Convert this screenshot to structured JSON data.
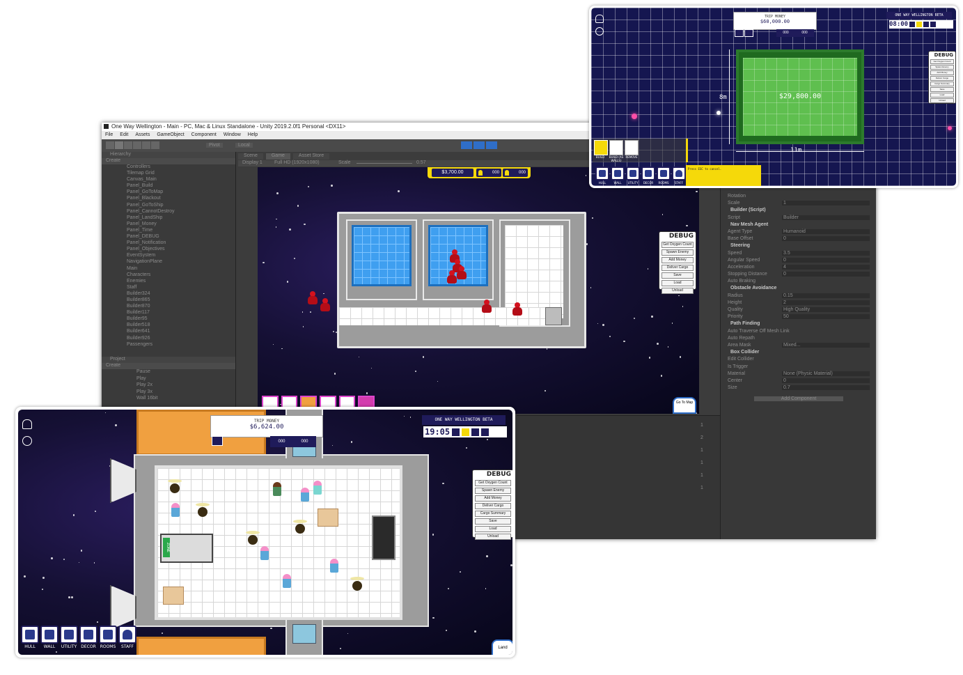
{
  "unity": {
    "title": "One Way Wellington - Main - PC, Mac & Linux Standalone - Unity 2019.2.0f1 Personal <DX11>",
    "menu": [
      "File",
      "Edit",
      "Assets",
      "GameObject",
      "Component",
      "Window",
      "Help"
    ],
    "pivot_label": "Pivot",
    "local_label": "Local",
    "hierarchy_tab": "Hierarchy",
    "scene_tab": "Scene",
    "game_tab": "Game",
    "asset_store_tab": "Asset Store",
    "display_label": "Display 1",
    "resolution_label": "Full HD (1920x1080)",
    "scale_label": "Scale",
    "scale_value": "0.57",
    "create_label": "Create",
    "project_tab": "Project",
    "hierarchy_items": [
      "Controllers",
      "Tilemap Grid",
      "Canvas_Main",
      "Panel_Build",
      "Panel_GoToMap",
      "Panel_Blackout",
      "Panel_GoToShip",
      "Panel_CannotDestroy",
      "Panel_LandShip",
      "Panel_Money",
      "Panel_Time",
      "Panel_DEBUG",
      "Panel_Notification",
      "Panel_Objectives",
      "EventSystem",
      "NavigationPlane",
      "Main",
      "Characters",
      "Enemies",
      "Staff",
      "Builder324",
      "Builder865",
      "Builder870",
      "Builder117",
      "Builder95",
      "Builder518",
      "Builder641",
      "Builder926",
      "Passengers"
    ],
    "project_items": [
      "Pause",
      "Play",
      "Play 2x",
      "Play 3x",
      "Wall 16bit"
    ],
    "inspector": {
      "rotation_label": "Rotation",
      "scale_label": "Scale",
      "builder_script": "Builder (Script)",
      "script_label": "Script",
      "script_value": "Builder",
      "nav_mesh_agent": "Nav Mesh Agent",
      "agent_type_label": "Agent Type",
      "agent_type_value": "Humanoid",
      "base_offset_label": "Base Offset",
      "base_offset_value": "0",
      "steering_header": "Steering",
      "speed_label": "Speed",
      "speed_value": "3.5",
      "angular_speed_label": "Angular Speed",
      "angular_speed_value": "0",
      "acceleration_label": "Acceleration",
      "acceleration_value": "4",
      "stopping_distance_label": "Stopping Distance",
      "stopping_distance_value": "0",
      "auto_braking_label": "Auto Braking",
      "obstacle_header": "Obstacle Avoidance",
      "radius_label": "Radius",
      "radius_value": "0.15",
      "height_label": "Height",
      "height_value": "2",
      "quality_label": "Quality",
      "quality_value": "High Quality",
      "priority_label": "Priority",
      "priority_value": "50",
      "path_header": "Path Finding",
      "auto_traverse_label": "Auto Traverse Off Mesh Link",
      "auto_repath_label": "Auto Repath",
      "area_mask_label": "Area Mask",
      "area_mask_value": "Mixed...",
      "box_collider": "Box Collider",
      "edit_collider_label": "Edit Collider",
      "is_trigger_label": "Is Trigger",
      "material_label": "Material",
      "material_value": "None (Physic Material)",
      "center_label": "Center",
      "size_label": "Size",
      "center_x": "0",
      "center_y": "0",
      "center_z": "0.25",
      "size_x": "0.7",
      "size_y": "1",
      "size_z": "1",
      "scale_x": "1",
      "scale_y": "1",
      "scale_z": "1",
      "add_component": "Add Component"
    },
    "console_numbers": [
      "1",
      "2",
      "1",
      "1",
      "1",
      "1"
    ]
  },
  "game_mid": {
    "money": "$3,700.00",
    "count_a": "000",
    "count_b": "000",
    "go_to_map": "Go To Map"
  },
  "debug": {
    "title": "DEBUG",
    "buttons": [
      "Get Oxygen Count",
      "Spawn Enemy",
      "Add Money",
      "Deliver Cargo",
      "Save",
      "Load",
      "Unload"
    ]
  },
  "debug_bottom": {
    "buttons": [
      "Get Oxygen Count",
      "Spawn Enemy",
      "Add Money",
      "Deliver Cargo",
      "Cargo Summary",
      "Save",
      "Load",
      "Unload"
    ]
  },
  "debug_top": {
    "buttons": [
      "Get Oxygen Count",
      "Spawn Enemy",
      "Add Money",
      "Deliver Cargo",
      "Cargo Summary",
      "Save",
      "Load",
      "Unload"
    ]
  },
  "game_top": {
    "trip_money_label": "TRIP MONEY",
    "trip_money_value": "$60,000.00",
    "beta_label": "ONE WAY WELLINGTON BETA",
    "time": "08:00",
    "count_a": "000",
    "count_b": "000",
    "room_cost": "$29,800.00",
    "dim_height": "8m",
    "dim_width": "11m",
    "build_label": "BUILD",
    "build_walls_label": "BUILD (AS WALLS)",
    "remove_label": "REMOVE",
    "escape_hint": "Press ESC to cancel.",
    "hud_labels": [
      "HULL",
      "WALL",
      "UTILITY",
      "DECOR",
      "ROOMS",
      "STAFF"
    ]
  },
  "game_bottom": {
    "trip_money_label": "TRIP MONEY",
    "trip_money_value": "$6,624.00",
    "beta_label": "ONE WAY WELLINGTON BETA",
    "time": "19:05",
    "count_a": "000",
    "count_b": "000",
    "zone_label": "ZONE",
    "land_label": "Land",
    "hud_labels": [
      "HULL",
      "WALL",
      "UTILITY",
      "DECOR",
      "ROOMS",
      "STAFF"
    ]
  },
  "colors": {
    "hud_navy": "#1f1b5a",
    "accent_yellow": "#f5d90a",
    "unity_bg": "#3c3c3c",
    "room_cost_green": "#4bb543"
  }
}
